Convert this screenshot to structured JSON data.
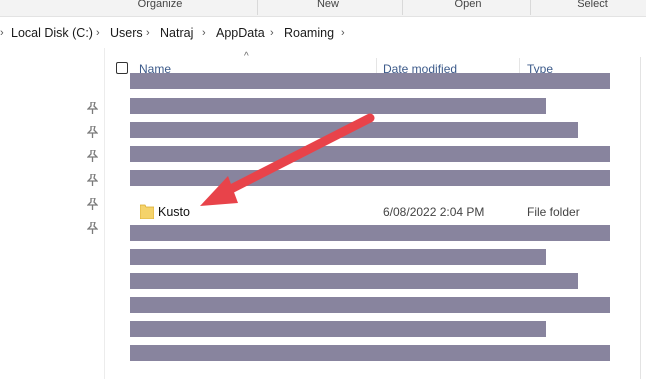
{
  "ribbon": {
    "groups": [
      {
        "label": "Organize"
      },
      {
        "label": "New"
      },
      {
        "label": "Open"
      },
      {
        "label": "Select"
      }
    ]
  },
  "breadcrumb": {
    "items": [
      "Local Disk (C:)",
      "Users",
      "Natraj",
      "AppData",
      "Roaming"
    ]
  },
  "columns": {
    "name": "Name",
    "date_modified": "Date modified",
    "type": "Type"
  },
  "highlighted_row": {
    "name": "Kusto",
    "date_modified": "6/08/2022 2:04 PM",
    "type": "File folder",
    "icon": "folder-icon"
  },
  "colors": {
    "redaction": "#88849e",
    "arrow": "#e8434a",
    "folder": "#f5d36b"
  }
}
